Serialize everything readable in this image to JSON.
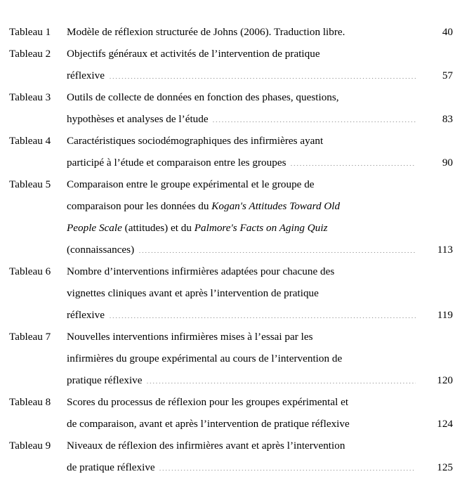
{
  "document": {
    "type": "list-of-tables",
    "language": "fr",
    "label_prefix": "Tableau"
  },
  "entries": [
    {
      "label": "Tableau 1",
      "page": "40",
      "lines": [
        {
          "text": "Modèle de réflexion structurée de Johns (2006). Traduction libre.",
          "leader": false,
          "page": "40"
        }
      ]
    },
    {
      "label": "Tableau 2",
      "page": "57",
      "lines": [
        {
          "text": "Objectifs généraux et activités de l’intervention de pratique",
          "leader": false,
          "page": ""
        },
        {
          "text": "réflexive ",
          "leader": true,
          "page": "57"
        }
      ]
    },
    {
      "label": "Tableau 3",
      "page": "83",
      "lines": [
        {
          "text": "Outils de collecte de données en fonction des phases, questions,",
          "leader": false,
          "page": ""
        },
        {
          "text": "hypothèses et analyses de l’étude ",
          "leader": true,
          "page": "83"
        }
      ]
    },
    {
      "label": "Tableau 4",
      "page": "90",
      "lines": [
        {
          "text": "Caractéristiques sociodémographiques des infirmières ayant",
          "leader": false,
          "page": ""
        },
        {
          "text": "participé à l’étude et comparaison entre les groupes ",
          "leader": true,
          "page": "90"
        }
      ]
    },
    {
      "label": "Tableau 5",
      "page": "113",
      "lines": [
        {
          "text": "Comparaison entre le groupe expérimental et le groupe de",
          "leader": false,
          "page": ""
        },
        {
          "text_html": "comparaison pour les données du <i>Kogan's Attitudes Toward Old</i>",
          "leader": false,
          "page": ""
        },
        {
          "text_html": "<i>People Scale</i> (attitudes) et du <i>Palmore's Facts on Aging Quiz</i>",
          "leader": false,
          "page": ""
        },
        {
          "text": "(connaissances) ",
          "leader": true,
          "page": "113"
        }
      ]
    },
    {
      "label": "Tableau 6",
      "page": "119",
      "lines": [
        {
          "text": "Nombre d’interventions infirmières adaptées pour chacune des",
          "leader": false,
          "page": ""
        },
        {
          "text": "vignettes cliniques avant et après l’intervention de pratique",
          "leader": false,
          "page": ""
        },
        {
          "text": "réflexive ",
          "leader": true,
          "page": "119"
        }
      ]
    },
    {
      "label": "Tableau 7",
      "page": "120",
      "lines": [
        {
          "text": "Nouvelles interventions infirmières mises à l’essai par les",
          "leader": false,
          "page": ""
        },
        {
          "text": "infirmières du groupe expérimental au cours de l’intervention de",
          "leader": false,
          "page": ""
        },
        {
          "text": "pratique réflexive ",
          "leader": true,
          "page": "120"
        }
      ]
    },
    {
      "label": "Tableau 8",
      "page": "124",
      "lines": [
        {
          "text": "Scores du processus de réflexion pour les groupes expérimental et",
          "leader": false,
          "page": ""
        },
        {
          "text": "de comparaison, avant et après l’intervention de pratique réflexive",
          "leader": false,
          "page": "124"
        }
      ]
    },
    {
      "label": "Tableau 9",
      "page": "125",
      "lines": [
        {
          "text": "Niveaux de réflexion des infirmières avant et après l’intervention",
          "leader": false,
          "page": ""
        },
        {
          "text": "de pratique réflexive ",
          "leader": true,
          "page": "125"
        }
      ]
    }
  ]
}
